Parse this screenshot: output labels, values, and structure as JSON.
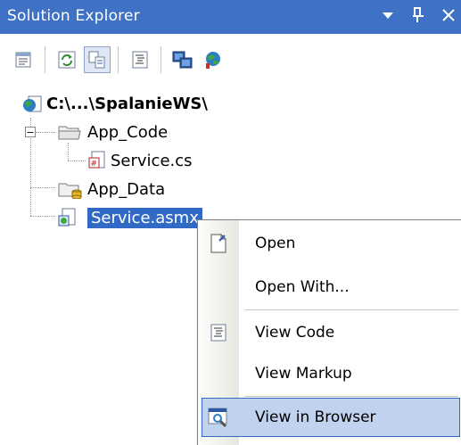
{
  "panel": {
    "title": "Solution Explorer",
    "controls": {
      "dropdown": "▼",
      "pin": "ᴾ",
      "close": "✕"
    }
  },
  "toolbar": {
    "buttons": [
      {
        "icon": "properties-icon"
      },
      {
        "icon": "refresh-icon"
      },
      {
        "icon": "nest-related-files-icon"
      },
      {
        "icon": "view-code-icon"
      },
      {
        "icon": "copy-website-icon"
      },
      {
        "icon": "asp-net-configuration-icon"
      }
    ]
  },
  "tree": {
    "root": "C:\\...\\SpalanieWS\\",
    "items": [
      {
        "label": "App_Code",
        "icon": "folder-icon"
      },
      {
        "label": "Service.cs",
        "icon": "cs-file-icon"
      },
      {
        "label": "App_Data",
        "icon": "data-folder-icon"
      },
      {
        "label": "Service.asmx",
        "icon": "asmx-file-icon"
      }
    ]
  },
  "context_menu": {
    "items": [
      {
        "label": "Open",
        "icon": "open-file-icon"
      },
      {
        "label": "Open With..."
      },
      {
        "label": "View Code",
        "icon": "view-code-icon"
      },
      {
        "label": "View Markup"
      },
      {
        "label": "View in Browser",
        "icon": "browser-icon"
      }
    ]
  },
  "colors": {
    "title_bar": "#3f71c5",
    "selection": "#316ac5",
    "menu_highlight": "#c1d2ee"
  }
}
